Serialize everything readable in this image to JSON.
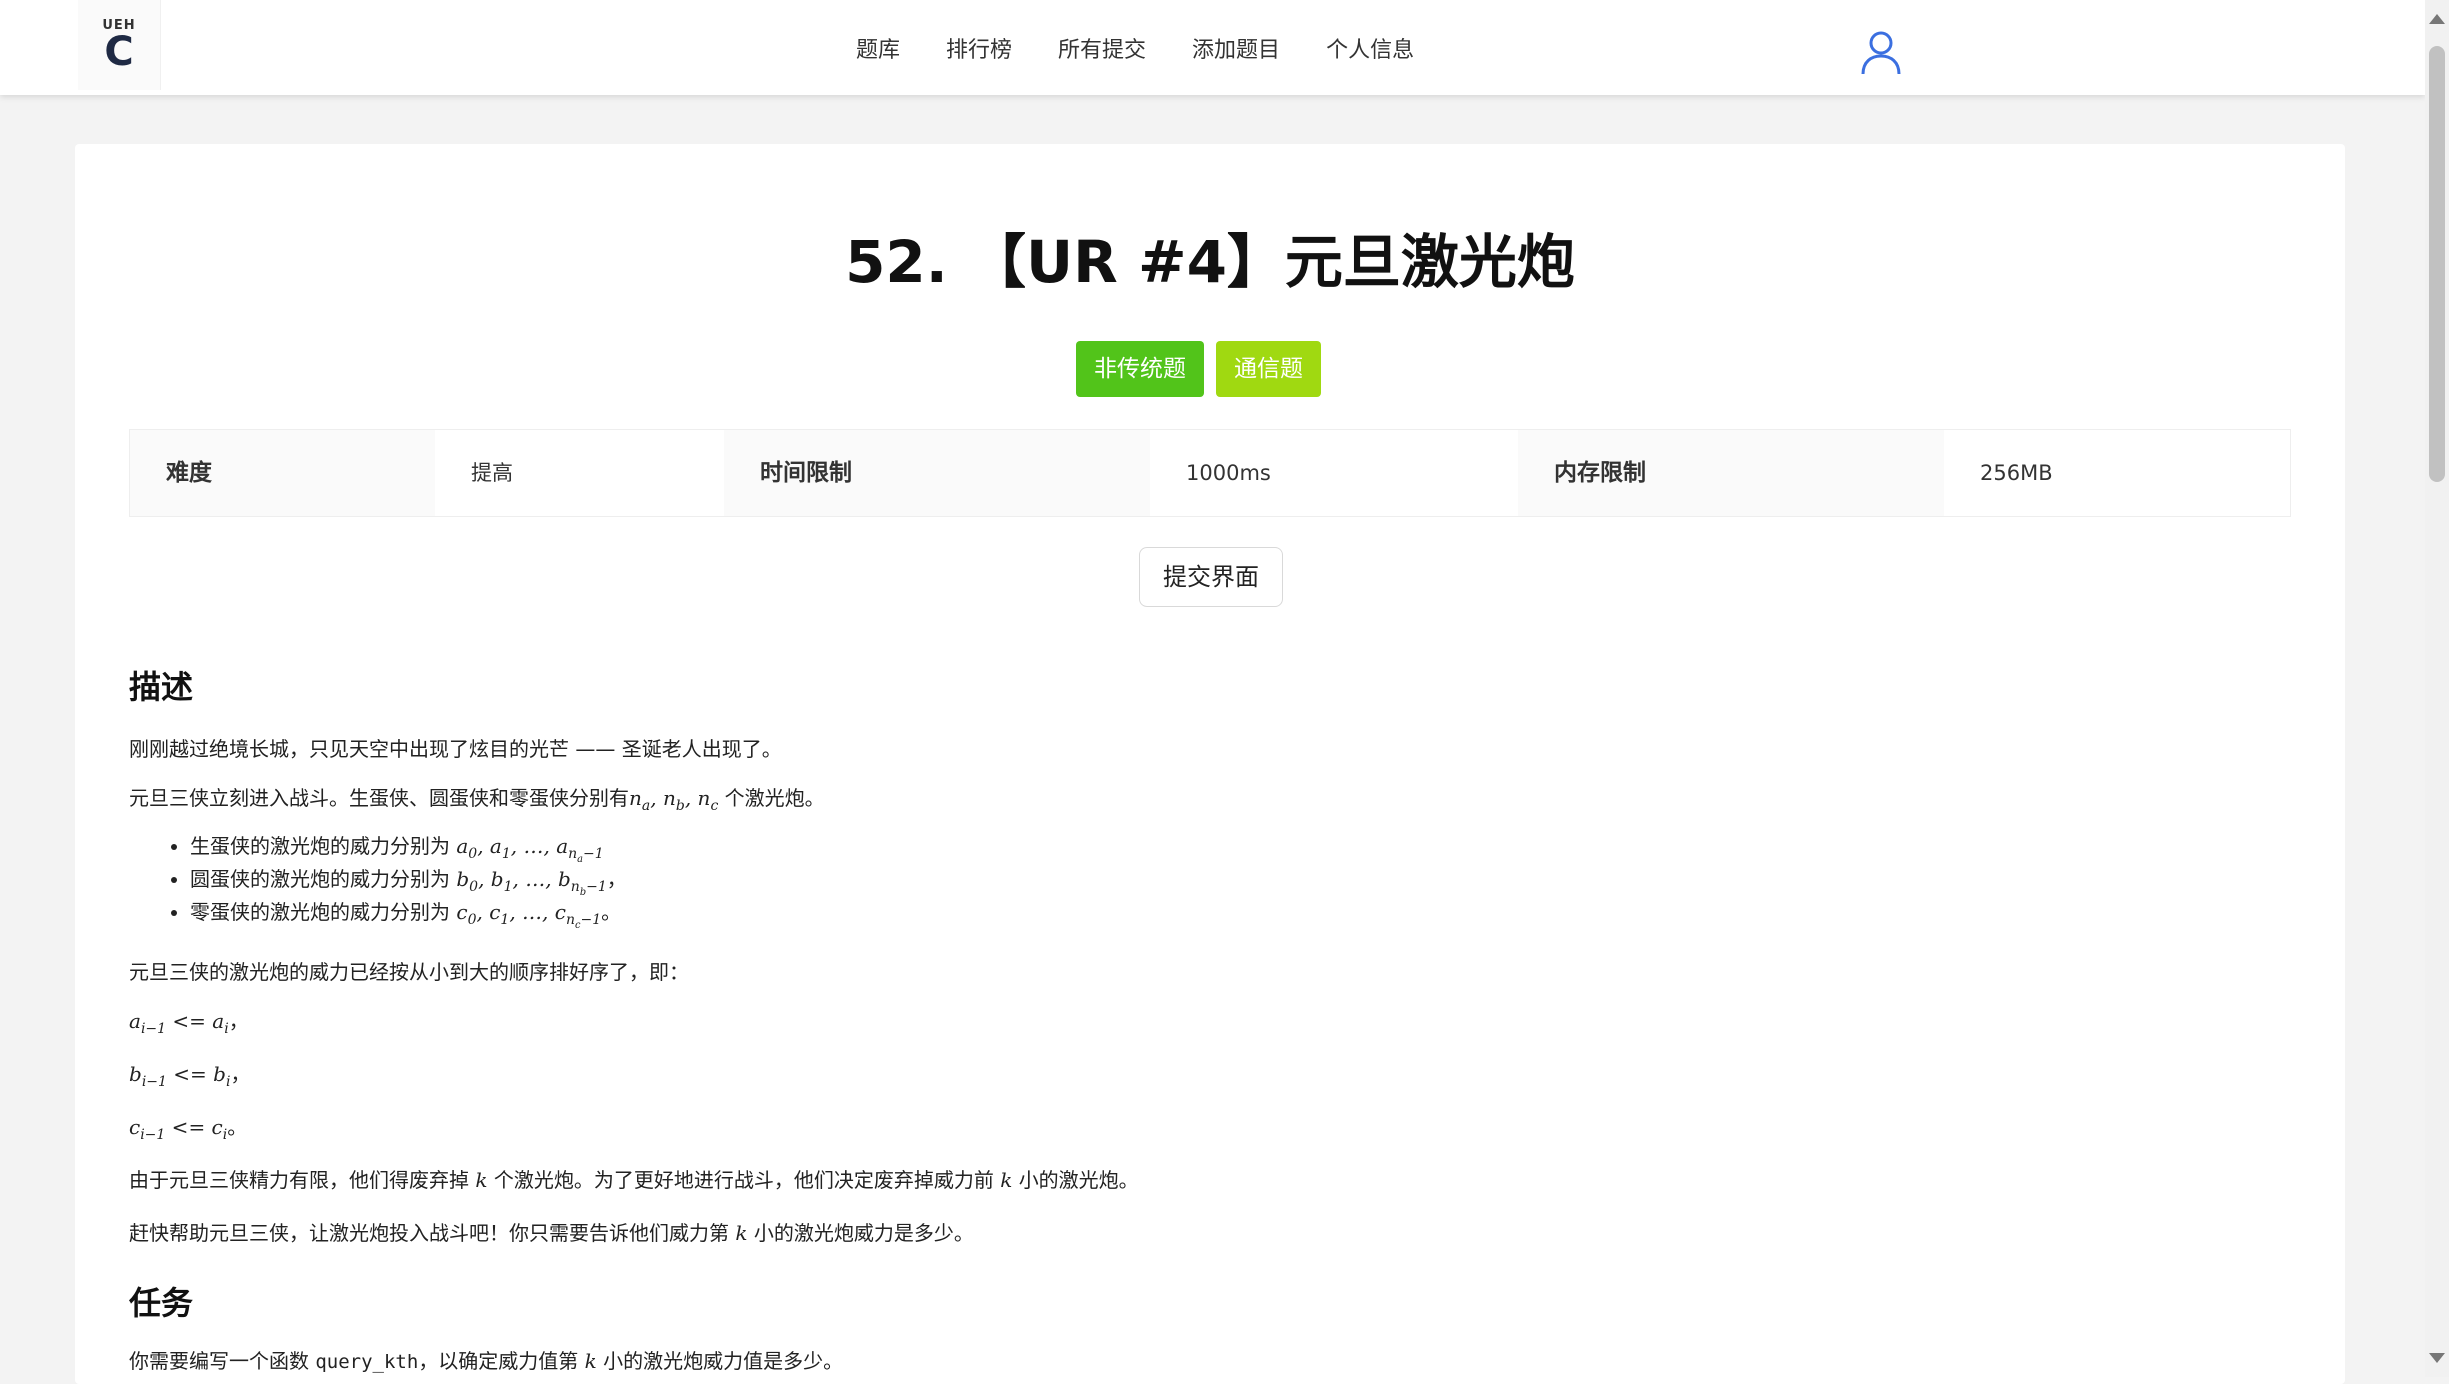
{
  "header": {
    "logo": {
      "mark_text": "UEH",
      "letter": "C"
    },
    "nav": [
      "题库",
      "排行榜",
      "所有提交",
      "添加题目",
      "个人信息"
    ],
    "user_icon": "user-icon"
  },
  "problem": {
    "title": "52. 【UR #4】元旦激光炮",
    "tags": [
      {
        "label": "非传统题",
        "color": "#52c41a"
      },
      {
        "label": "通信题",
        "color": "#a0d911"
      }
    ],
    "info": {
      "difficulty_label": "难度",
      "difficulty_value": "提高",
      "time_label": "时间限制",
      "time_value": "1000ms",
      "memory_label": "内存限制",
      "memory_value": "256MB"
    },
    "submit_label": "提交界面"
  },
  "description": {
    "heading": "描述",
    "p1": "刚刚越过绝境长城，只见天空中出现了炫目的光芒 —— 圣诞老人出现了。",
    "p2_prefix": "元旦三侠立刻进入战斗。生蛋侠、圆蛋侠和零蛋侠分别有",
    "p2_suffix": "个激光炮。",
    "bullets": [
      {
        "prefix": "生蛋侠的激光炮的威力分别为",
        "var": "a",
        "sub_last": "na",
        "end": ""
      },
      {
        "prefix": "圆蛋侠的激光炮的威力分别为",
        "var": "b",
        "sub_last": "nb",
        "end": "，"
      },
      {
        "prefix": "零蛋侠的激光炮的威力分别为",
        "var": "c",
        "sub_last": "nc",
        "end": "。"
      }
    ],
    "p3": "元旦三侠的激光炮的威力已经按从小到大的顺序排好序了，即：",
    "inequalities": [
      {
        "var": "a",
        "end": "，"
      },
      {
        "var": "b",
        "end": "，"
      },
      {
        "var": "c",
        "end": "。"
      }
    ],
    "p4_a": "由于元旦三侠精力有限，他们得废弃掉",
    "p4_b": "个激光炮。为了更好地进行战斗，他们决定废弃掉威力前",
    "p4_c": "小的激光炮。",
    "p5_a": "赶快帮助元旦三侠，让激光炮投入战斗吧！你只需要告诉他们威力第",
    "p5_b": "小的激光炮威力是多少。"
  },
  "task": {
    "heading": "任务",
    "p1_a": "你需要编写一个函数",
    "function_name": "query_kth",
    "p1_b": "，以确定威力值第",
    "p1_c": "小的激光炮威力值是多少。"
  }
}
